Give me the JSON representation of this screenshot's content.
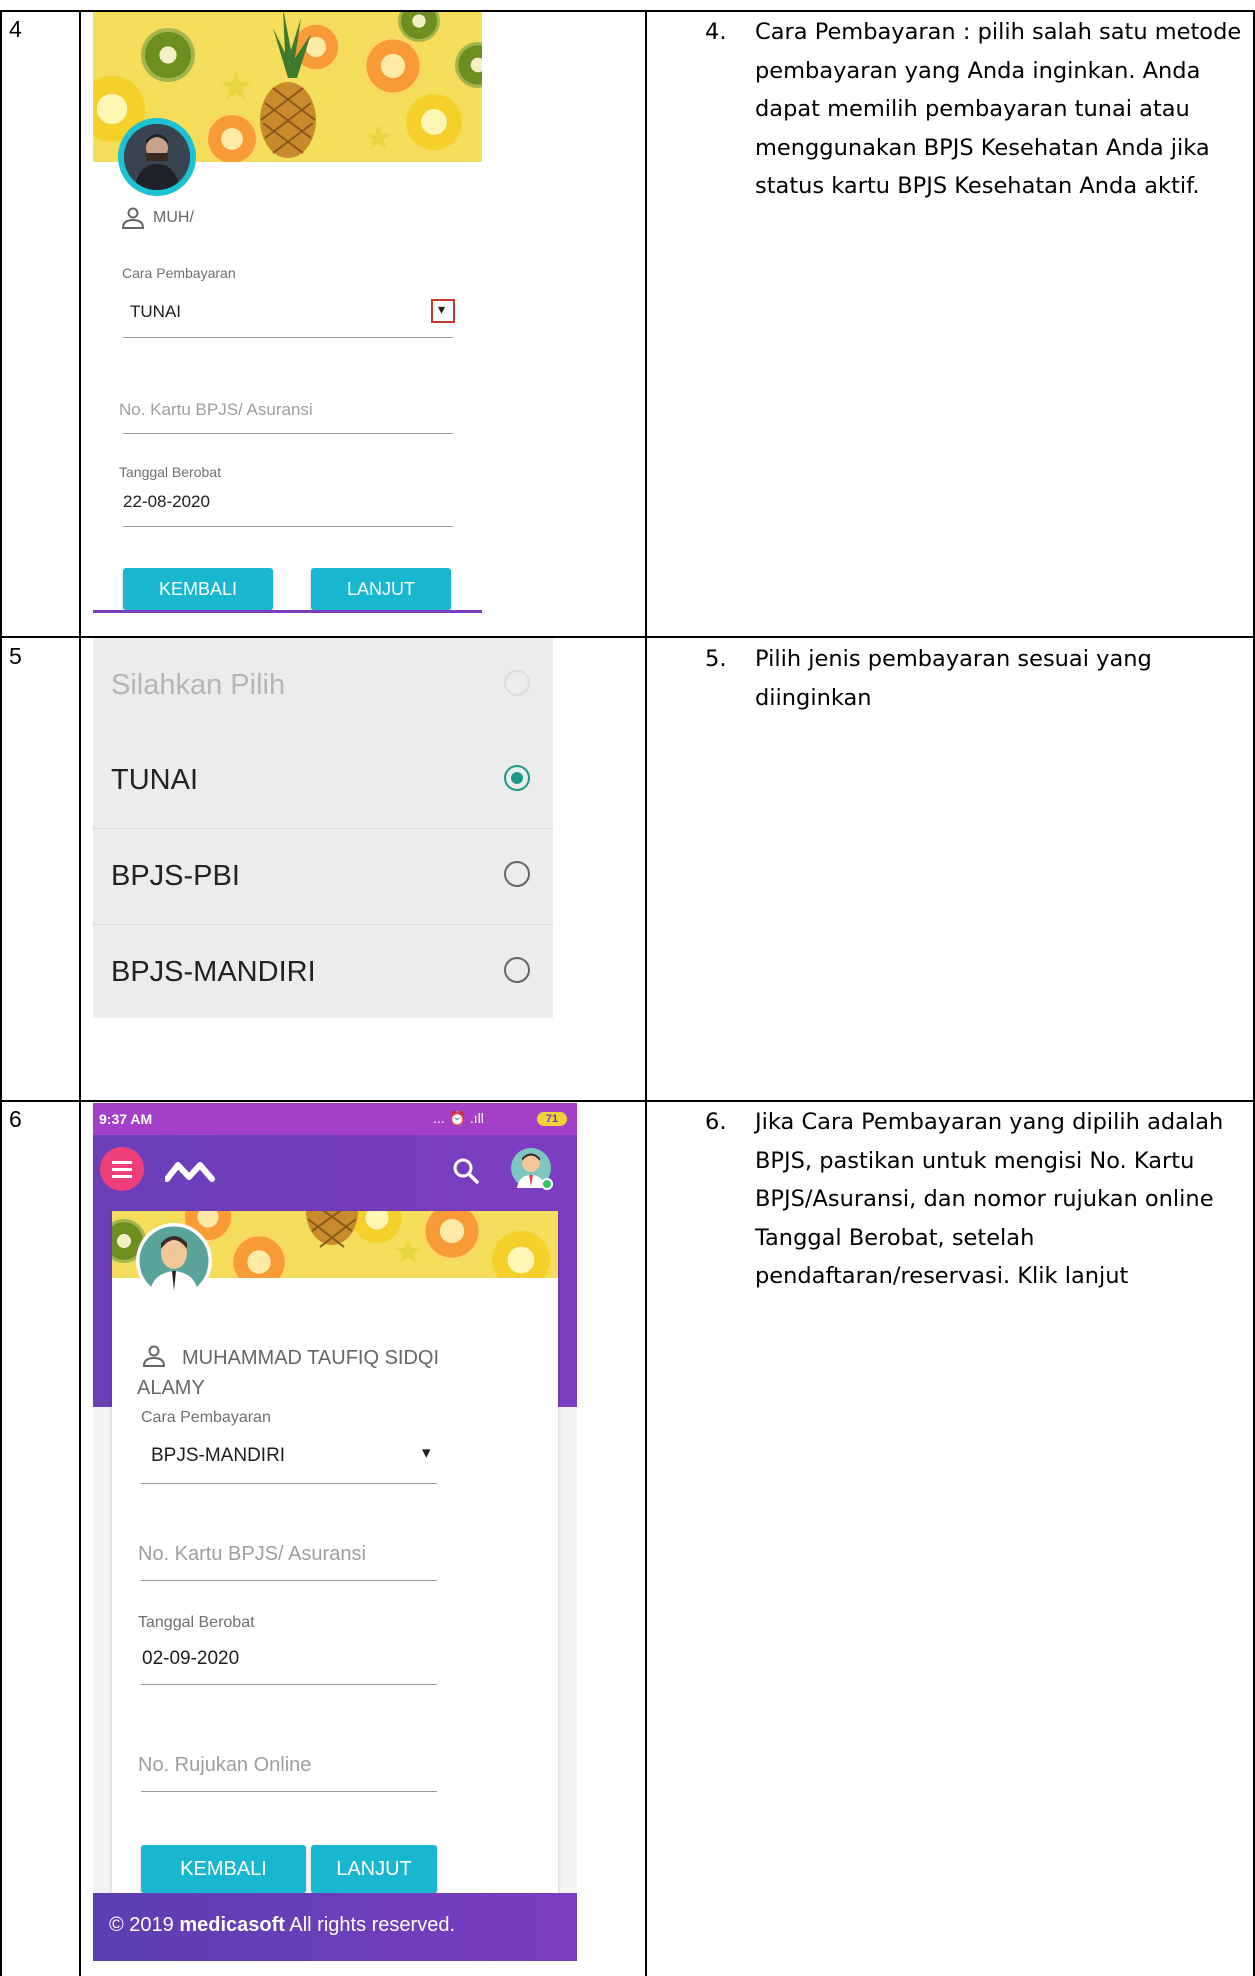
{
  "rows": [
    {
      "number": "4",
      "instruction_number": "4.",
      "instruction": "Cara Pembayaran : pilih salah satu metode pembayaran yang Anda inginkan. Anda dapat memilih pembayaran tunai atau menggunakan BPJS Kesehatan Anda jika status kartu BPJS Kesehatan Anda aktif.",
      "screen": {
        "user_name": "MUH/",
        "payment_label": "Cara Pembayaran",
        "payment_value": "TUNAI",
        "dropdown_arrow": "▾",
        "card_placeholder": "No. Kartu BPJS/ Asuransi",
        "date_label": "Tanggal Berobat",
        "date_value": "22-08-2020",
        "back_button": "KEMBALI",
        "next_button": "LANJUT"
      }
    },
    {
      "number": "5",
      "instruction_number": "5.",
      "instruction": "Pilih jenis pembayaran sesuai yang diinginkan",
      "options": [
        {
          "label": "Silahkan Pilih",
          "selected": false,
          "disabled": true
        },
        {
          "label": "TUNAI",
          "selected": true
        },
        {
          "label": "BPJS-PBI",
          "selected": false
        },
        {
          "label": "BPJS-MANDIRI",
          "selected": false
        }
      ]
    },
    {
      "number": "6",
      "instruction_number": "6.",
      "instruction": "Jika Cara Pembayaran yang dipilih adalah BPJS, pastikan untuk mengisi No. Kartu BPJS/Asuransi, dan nomor rujukan online Tanggal Berobat, setelah pendaftaran/reservasi. Klik lanjut",
      "screen": {
        "time": "9:37 AM",
        "status_icons": "... ⏰ .ıll",
        "battery": "71",
        "user_name_line1": "MUHAMMAD TAUFIQ SIDQI",
        "user_name_line2": "ALAMY",
        "payment_label": "Cara Pembayaran",
        "payment_value": "BPJS-MANDIRI",
        "dropdown_arrow": "▾",
        "card_placeholder": "No. Kartu BPJS/ Asuransi",
        "date_label": "Tanggal Berobat",
        "date_value": "02-09-2020",
        "referral_placeholder": "No. Rujukan Online",
        "back_button": "KEMBALI",
        "next_button": "LANJUT",
        "footer_prefix": "© 2019 ",
        "footer_brand": "medicasoft",
        "footer_suffix": " All rights reserved."
      }
    }
  ],
  "colors": {
    "accent": "#18b7cf",
    "purple": "#7d3dc2",
    "menu_pink": "#ee3f7a",
    "radio_green": "#1a9a88"
  },
  "icons": [
    "person-icon",
    "dropdown-icon",
    "menu-icon",
    "logo-icon",
    "search-icon",
    "avatar-icon",
    "radio-icon"
  ]
}
